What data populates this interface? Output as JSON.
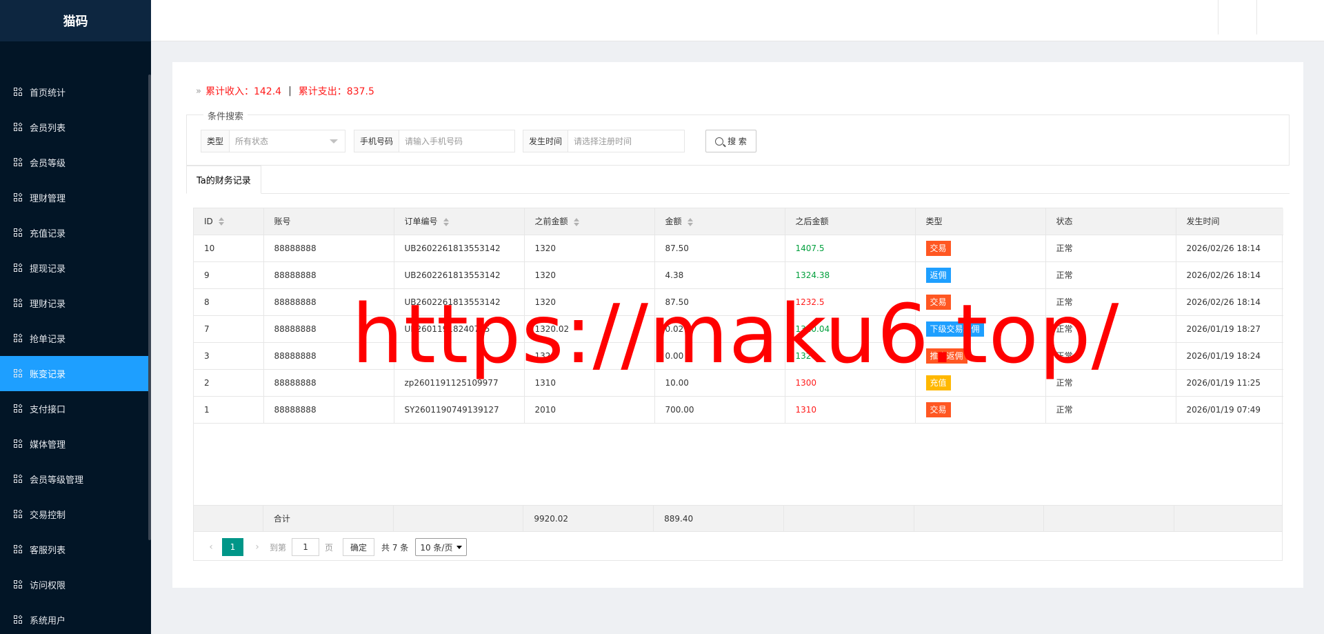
{
  "app": {
    "logo": "猫码"
  },
  "sidebar": {
    "items": [
      {
        "label": "首页统计"
      },
      {
        "label": "会员列表"
      },
      {
        "label": "会员等级"
      },
      {
        "label": "理财管理"
      },
      {
        "label": "充值记录"
      },
      {
        "label": "提现记录"
      },
      {
        "label": "理财记录"
      },
      {
        "label": "抢单记录"
      },
      {
        "label": "账变记录",
        "active": true
      },
      {
        "label": "支付接口"
      },
      {
        "label": "媒体管理"
      },
      {
        "label": "会员等级管理"
      },
      {
        "label": "交易控制"
      },
      {
        "label": "客服列表"
      },
      {
        "label": "访问权限"
      },
      {
        "label": "系统用户"
      }
    ]
  },
  "summary": {
    "income": "累计收入：142.4",
    "sep": "|",
    "expense": "累计支出：837.5"
  },
  "search": {
    "legend": "条件搜索",
    "type_label": "类型",
    "type_value": "所有状态",
    "phone_label": "手机号码",
    "phone_placeholder": "请输入手机号码",
    "time_label": "发生时间",
    "time_placeholder": "请选择注册时间",
    "button": "搜 索"
  },
  "tab": {
    "label": "Ta的财务记录"
  },
  "table": {
    "headers": [
      "ID",
      "账号",
      "订单编号",
      "之前金额",
      "金额",
      "之后金额",
      "类型",
      "状态",
      "发生时间"
    ],
    "rows": [
      {
        "id": "10",
        "account": "88888888",
        "order": "UB2602261813553142",
        "before": "1320",
        "amount": "87.50",
        "after": "1407.5",
        "after_color": "green",
        "type": "交易",
        "type_color": "orange",
        "status": "正常",
        "time": "2026/02/26 18:14"
      },
      {
        "id": "9",
        "account": "88888888",
        "order": "UB2602261813553142",
        "before": "1320",
        "amount": "4.38",
        "after": "1324.38",
        "after_color": "green",
        "type": "返佣",
        "type_color": "blue",
        "status": "正常",
        "time": "2026/02/26 18:14"
      },
      {
        "id": "8",
        "account": "88888888",
        "order": "UB2602261813553142",
        "before": "1320",
        "amount": "87.50",
        "after": "1232.5",
        "after_color": "red",
        "type": "交易",
        "type_color": "orange",
        "status": "正常",
        "time": "2026/02/26 18:14"
      },
      {
        "id": "7",
        "account": "88888888",
        "order": "UB26011918240755",
        "before": "1320.02",
        "amount": "0.02",
        "after": "1320.04",
        "after_color": "green",
        "type": "下级交易返佣",
        "type_color": "blue",
        "status": "正常",
        "time": "2026/01/19 18:27"
      },
      {
        "id": "3",
        "account": "88888888",
        "order": "",
        "before": "1320",
        "amount": "0.00",
        "after": "1320",
        "after_color": "green",
        "type": "推广返佣",
        "type_color": "orange",
        "status": "正常",
        "time": "2026/01/19 18:24"
      },
      {
        "id": "2",
        "account": "88888888",
        "order": "zp2601191125109977",
        "before": "1310",
        "amount": "10.00",
        "after": "1300",
        "after_color": "red",
        "type": "充值",
        "type_color": "yellow",
        "status": "正常",
        "time": "2026/01/19 11:25"
      },
      {
        "id": "1",
        "account": "88888888",
        "order": "SY2601190749139127",
        "before": "2010",
        "amount": "700.00",
        "after": "1310",
        "after_color": "red",
        "type": "交易",
        "type_color": "orange",
        "status": "正常",
        "time": "2026/01/19 07:49"
      }
    ],
    "total_label": "合计",
    "total_before": "9920.02",
    "total_amount": "889.40"
  },
  "pager": {
    "prev": "‹",
    "current": "1",
    "next": "›",
    "goto_label": "到第",
    "goto_value": "1",
    "page_label": "页",
    "confirm": "确定",
    "count": "共 7 条",
    "page_size": "10 条/页"
  },
  "watermark": "https://maku6.top/",
  "colors": {
    "sidebar_bg": "#021526",
    "active": "#1e9fff",
    "green": "#009f3c",
    "red": "#ff1a1a",
    "orange": "#ff5722",
    "yellow": "#ffb800",
    "pager": "#009688"
  }
}
